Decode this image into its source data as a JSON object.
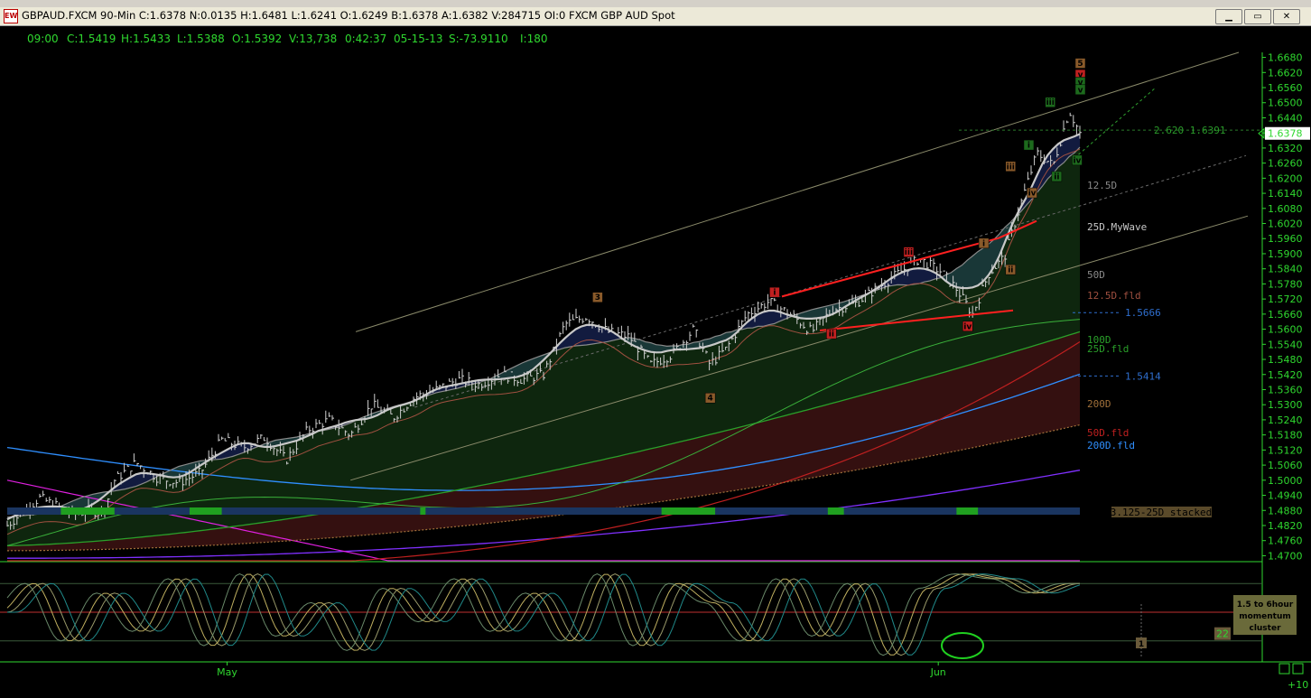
{
  "window": {
    "title": "GBPAUD.FXCM 90-Min C:1.6378 N:0.0135 H:1.6481 L:1.6241 O:1.6249 B:1.6378 A:1.6382 V:284715 OI:0 FXCM GBP AUD Spot",
    "buttons": [
      "▁",
      "▭",
      "✕"
    ]
  },
  "info_bar": {
    "time": "09:00",
    "close": "C:1.5419",
    "high": "H:1.5433",
    "low": "L:1.5388",
    "open": "O:1.5392",
    "volume": "V:13,738",
    "elapsed": "0:42:37",
    "date": "05-15-13",
    "s_value": "S:-73.9110",
    "i_value": "I:180"
  },
  "colors": {
    "background": "#000000",
    "axis_text": "#2fd82f",
    "price_tag": "#ff00ff",
    "trendline": "#ff2020",
    "channel": "#8a8a6a",
    "ma_25d": "#c8c8c8",
    "ma_100d": "#2aa02a",
    "ma_200d": "#a0703a",
    "ma_200d_fld": "#2f8fff",
    "ma_50d": "#8a8a8a",
    "magenta_line": "#e020e0",
    "purple_line": "#8030ff",
    "red_rising": "#c02020",
    "stacked_bar": "#1a3560",
    "stacked_active": "#20a020"
  },
  "price_tag": "1.6378",
  "price_tag_value": 1.6378,
  "labels": {
    "fib": "2.620 1.6391",
    "level_12_5d": "12.5D",
    "level_25d_mywave": "25D.MyWave",
    "level_50d": "50D",
    "level_12_5d_fld": "12.5D.fld",
    "level_1_5666": "1.5666",
    "level_100d": "100D",
    "level_25d_fld": "25D.fld",
    "level_1_5414": "1.5414",
    "level_200d": "200D",
    "level_50d_fld": "50D.fld",
    "level_200d_fld": "200D.fld",
    "stacked": "3.125-25D  stacked",
    "momentum_value": "22",
    "momentum_box": "1.5 to 6hour\nmomentum\ncluster",
    "mom_cycle": "1",
    "corner": "+10"
  },
  "wave_labels": [
    {
      "text": "3",
      "price": 1.5725,
      "x_index": 0.55,
      "color": "#8a5a2a"
    },
    {
      "text": "4",
      "price": 1.5325,
      "x_index": 0.655,
      "color": "#8a5a2a"
    },
    {
      "text": "i",
      "price": 1.5745,
      "x_index": 0.715,
      "color": "#c02020"
    },
    {
      "text": "ii",
      "price": 1.558,
      "x_index": 0.768,
      "color": "#c02020"
    },
    {
      "text": "iii",
      "price": 1.5905,
      "x_index": 0.84,
      "color": "#c02020"
    },
    {
      "text": "iv",
      "price": 1.561,
      "x_index": 0.895,
      "color": "#c02020"
    },
    {
      "text": "i",
      "price": 1.594,
      "x_index": 0.91,
      "color": "#8a5a2a"
    },
    {
      "text": "ii",
      "price": 1.5835,
      "x_index": 0.935,
      "color": "#8a5a2a"
    },
    {
      "text": "iii",
      "price": 1.6245,
      "x_index": 0.935,
      "color": "#8a5a2a"
    },
    {
      "text": "iv",
      "price": 1.614,
      "x_index": 0.955,
      "color": "#8a5a2a"
    },
    {
      "text": "i",
      "price": 1.633,
      "x_index": 0.952,
      "color": "#1d6a1d"
    },
    {
      "text": "ii",
      "price": 1.6205,
      "x_index": 0.978,
      "color": "#1d6a1d"
    },
    {
      "text": "iii",
      "price": 1.65,
      "x_index": 0.972,
      "color": "#1d6a1d"
    },
    {
      "text": "iv",
      "price": 1.627,
      "x_index": 0.997,
      "color": "#1d6a1d"
    },
    {
      "text": "5",
      "price": 1.6655,
      "x_index": 1.0,
      "color": "#8a5a2a"
    },
    {
      "text": "v",
      "price": 1.661,
      "x_index": 1.0,
      "color": "#c02020"
    },
    {
      "text": "v",
      "price": 1.658,
      "x_index": 1.0,
      "color": "#1d6a1d"
    },
    {
      "text": "v",
      "price": 1.655,
      "x_index": 1.0,
      "color": "#1d6a1d"
    }
  ],
  "chart_data": [
    {
      "type": "line",
      "title": "GBPAUD.FXCM 90-Min",
      "x_labels": [
        "May",
        "Jun"
      ],
      "x_label_index": [
        0.205,
        0.868
      ],
      "ylim": [
        1.468,
        1.67
      ],
      "y_ticks": [
        1.668,
        1.662,
        1.656,
        1.65,
        1.644,
        1.638,
        1.632,
        1.626,
        1.62,
        1.614,
        1.608,
        1.602,
        1.596,
        1.59,
        1.584,
        1.578,
        1.572,
        1.566,
        1.56,
        1.554,
        1.548,
        1.542,
        1.536,
        1.53,
        1.524,
        1.518,
        1.512,
        1.506,
        1.5,
        1.494,
        1.488,
        1.482,
        1.476,
        1.47
      ],
      "series": [
        {
          "style": "ohlc",
          "x": [
            0,
            0.03,
            0.06,
            0.09,
            0.1,
            0.12,
            0.14,
            0.16,
            0.18,
            0.2,
            0.22,
            0.24,
            0.26,
            0.28,
            0.3,
            0.32,
            0.34,
            0.36,
            0.38,
            0.4,
            0.42,
            0.44,
            0.46,
            0.48,
            0.5,
            0.52,
            0.54,
            0.56,
            0.58,
            0.6,
            0.62,
            0.64,
            0.655,
            0.67,
            0.69,
            0.71,
            0.73,
            0.75,
            0.77,
            0.79,
            0.81,
            0.83,
            0.85,
            0.87,
            0.885,
            0.9,
            0.915,
            0.93,
            0.945,
            0.96,
            0.975,
            0.99,
            1.0
          ],
          "values": [
            1.482,
            1.493,
            1.487,
            1.488,
            1.5,
            1.507,
            1.501,
            1.499,
            1.503,
            1.516,
            1.513,
            1.517,
            1.508,
            1.52,
            1.524,
            1.518,
            1.53,
            1.525,
            1.533,
            1.536,
            1.54,
            1.538,
            1.542,
            1.54,
            1.542,
            1.562,
            1.565,
            1.559,
            1.557,
            1.546,
            1.55,
            1.56,
            1.546,
            1.552,
            1.566,
            1.571,
            1.566,
            1.559,
            1.568,
            1.57,
            1.576,
            1.582,
            1.588,
            1.583,
            1.576,
            1.566,
            1.582,
            1.589,
            1.61,
            1.63,
            1.625,
            1.647,
            1.6378
          ]
        },
        {
          "name": "12.5D",
          "style": "line",
          "color": "#7a7a7a"
        },
        {
          "name": "25D.MyWave",
          "style": "line",
          "color": "#c8c8c8"
        },
        {
          "name": "50D",
          "style": "line",
          "color": "#8a8a8a"
        },
        {
          "name": "12.5D.fld",
          "style": "line",
          "color": "#a05040"
        },
        {
          "name": "100D",
          "style": "line",
          "color": "#2aa02a"
        },
        {
          "name": "25D.fld",
          "style": "line",
          "color": "#2aa02a"
        },
        {
          "name": "200D",
          "style": "line",
          "color": "#a0703a"
        },
        {
          "name": "50D.fld",
          "style": "line",
          "color": "#c02020"
        },
        {
          "name": "200D.fld",
          "style": "line",
          "color": "#2f8fff"
        }
      ],
      "levels": [
        1.6391,
        1.5666,
        1.5414
      ]
    },
    {
      "type": "line",
      "title": "",
      "series": [
        {
          "style": "oscillator",
          "values": [
            50,
            80,
            20,
            70,
            30,
            85,
            15,
            90,
            25,
            60,
            10,
            75,
            40,
            85,
            30,
            70,
            20,
            90,
            15,
            80,
            60,
            20,
            85,
            25,
            80,
            5,
            75,
            90,
            85,
            70,
            80
          ]
        }
      ],
      "reference_levels": [
        80,
        50,
        20
      ],
      "current_value": 22
    }
  ]
}
